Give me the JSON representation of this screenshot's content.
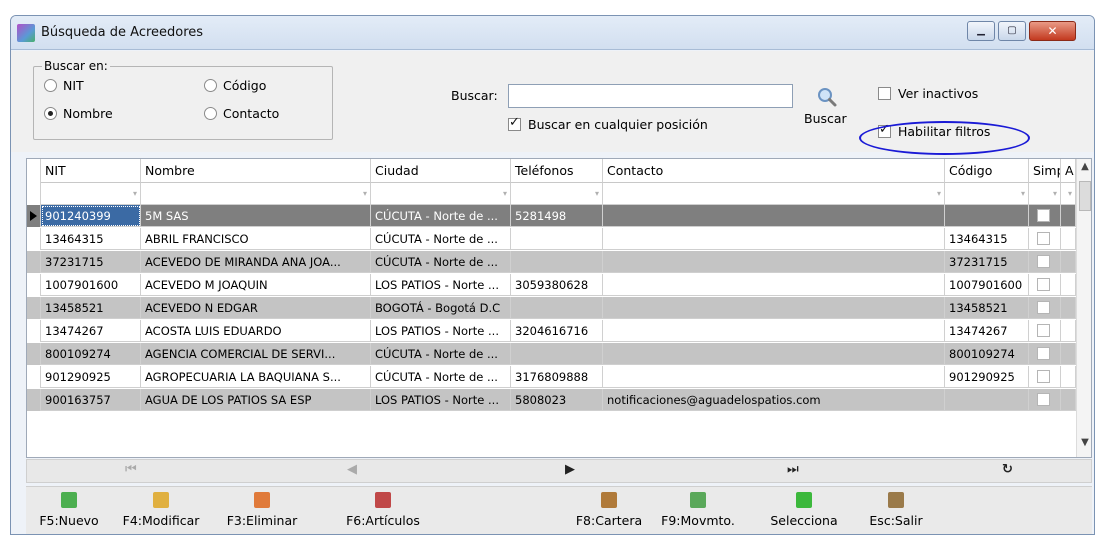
{
  "window": {
    "title": "Búsqueda de Acreedores",
    "min_icon": "minimize-icon",
    "max_icon": "maximize-icon",
    "close_icon": "close-icon",
    "min_glyph": "▁",
    "max_glyph": "▢",
    "close_glyph": "✕"
  },
  "search_in": {
    "legend": "Buscar en:",
    "options": [
      {
        "label": "NIT",
        "selected": false
      },
      {
        "label": "Código",
        "selected": false
      },
      {
        "label": "Nombre",
        "selected": true
      },
      {
        "label": "Contacto",
        "selected": false
      }
    ]
  },
  "search": {
    "label": "Buscar:",
    "value": "",
    "placeholder": "",
    "anywhere_label": "Buscar en cualquier posición",
    "anywhere_checked": true,
    "button_label": "Buscar",
    "button_icon": "magnifier-icon"
  },
  "options": {
    "inactive_label": "Ver inactivos",
    "inactive_checked": false,
    "filters_label": "Habilitar filtros",
    "filters_checked": true
  },
  "grid": {
    "columns": [
      "NIT",
      "Nombre",
      "Ciudad",
      "Teléfonos",
      "Contacto",
      "Código",
      "Simp",
      "A"
    ],
    "rows": [
      {
        "nit": "901240399",
        "nombre": "5M SAS",
        "ciudad": "CÚCUTA - Norte de ...",
        "telefonos": "5281498",
        "contacto": "",
        "codigo": "",
        "selected": true
      },
      {
        "nit": "13464315",
        "nombre": "ABRIL FRANCISCO",
        "ciudad": "CÚCUTA - Norte de ...",
        "telefonos": "",
        "contacto": "",
        "codigo": "13464315"
      },
      {
        "nit": "37231715",
        "nombre": "ACEVEDO DE MIRANDA ANA JOA...",
        "ciudad": "CÚCUTA - Norte de ...",
        "telefonos": "",
        "contacto": "",
        "codigo": "37231715"
      },
      {
        "nit": "1007901600",
        "nombre": "ACEVEDO M JOAQUIN",
        "ciudad": "LOS PATIOS - Norte ...",
        "telefonos": "3059380628",
        "contacto": "",
        "codigo": "1007901600"
      },
      {
        "nit": "13458521",
        "nombre": "ACEVEDO N EDGAR",
        "ciudad": "BOGOTÁ - Bogotá D.C",
        "telefonos": "",
        "contacto": "",
        "codigo": "13458521"
      },
      {
        "nit": "13474267",
        "nombre": "ACOSTA LUIS EDUARDO",
        "ciudad": "LOS PATIOS - Norte ...",
        "telefonos": "3204616716",
        "contacto": "",
        "codigo": "13474267"
      },
      {
        "nit": "800109274",
        "nombre": "AGENCIA COMERCIAL DE SERVI...",
        "ciudad": "CÚCUTA - Norte de ...",
        "telefonos": "",
        "contacto": "",
        "codigo": "800109274"
      },
      {
        "nit": "901290925",
        "nombre": "AGROPECUARIA LA BAQUIANA S...",
        "ciudad": "CÚCUTA - Norte de ...",
        "telefonos": "3176809888",
        "contacto": "",
        "codigo": "901290925"
      },
      {
        "nit": "900163757",
        "nombre": "AGUA DE LOS PATIOS SA ESP",
        "ciudad": "LOS PATIOS - Norte ...",
        "telefonos": "5808023",
        "contacto": "notificaciones@aguadelospatios.com",
        "codigo": ""
      }
    ]
  },
  "navigator": {
    "first": "⏮",
    "prior": "◀",
    "next": "▶",
    "last": "⏭",
    "refresh": "↻"
  },
  "toolbar": [
    {
      "label": "F5:Nuevo",
      "icon": "new-icon",
      "color": "#4caf50"
    },
    {
      "label": "F4:Modificar",
      "icon": "edit-icon",
      "color": "#e0b040"
    },
    {
      "label": "F3:Eliminar",
      "icon": "delete-icon",
      "color": "#e07a3a"
    },
    {
      "label": "F6:Artículos",
      "icon": "articles-icon",
      "color": "#c04848"
    },
    {
      "label": "F8:Cartera",
      "icon": "portfolio-icon",
      "color": "#b07a3a"
    },
    {
      "label": "F9:Movmto.",
      "icon": "movement-icon",
      "color": "#5aa85a"
    },
    {
      "label": "Selecciona",
      "icon": "select-icon",
      "color": "#3cb83c"
    },
    {
      "label": "Esc:Salir",
      "icon": "exit-icon",
      "color": "#9a7a4a"
    }
  ]
}
